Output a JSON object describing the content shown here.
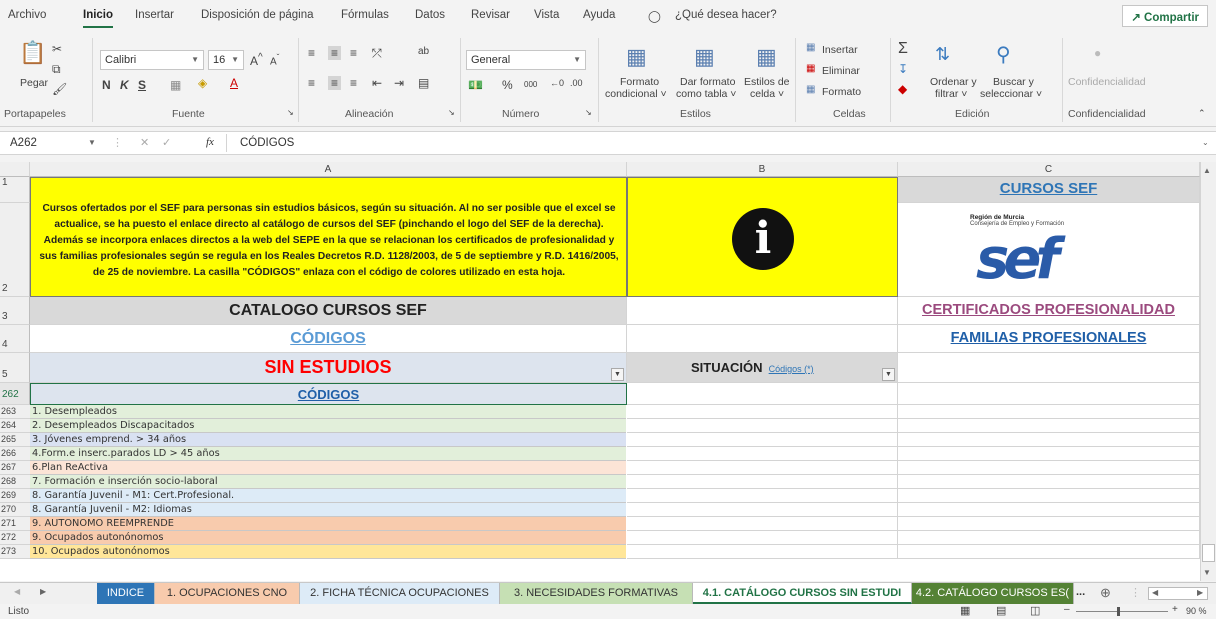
{
  "menu": {
    "items": [
      "Archivo",
      "Inicio",
      "Insertar",
      "Disposición de página",
      "Fórmulas",
      "Datos",
      "Revisar",
      "Vista",
      "Ayuda"
    ],
    "search_placeholder": "¿Qué desea hacer?",
    "share_label": "Compartir"
  },
  "ribbon": {
    "paste_label": "Pegar",
    "font_name": "Calibri",
    "font_size": "16",
    "bold": "N",
    "italic": "K",
    "underline": "S",
    "number_format": "General",
    "percent": "%",
    "thousands": "000",
    "cond_format_l1": "Formato",
    "cond_format_l2": "condicional ˅",
    "table_format_l1": "Dar formato",
    "table_format_l2": "como tabla ˅",
    "cell_styles_l1": "Estilos de",
    "cell_styles_l2": "celda ˅",
    "insert": "Insertar",
    "delete": "Eliminar",
    "format": "Formato",
    "sort_l1": "Ordenar y",
    "sort_l2": "filtrar ˅",
    "find_l1": "Buscar y",
    "find_l2": "seleccionar ˅",
    "confidential": "Confidencialidad",
    "groups": [
      "Portapapeles",
      "Fuente",
      "Alineación",
      "Número",
      "Estilos",
      "Celdas",
      "Edición",
      "Confidencialidad"
    ]
  },
  "formula_bar": {
    "name_box": "A262",
    "content": "CÓDIGOS"
  },
  "columns": [
    "A",
    "B",
    "C"
  ],
  "cells": {
    "a1_text": "Cursos ofertados por el SEF para personas sin estudios básicos, según su situación. Al no ser posible que el excel se actualice, se ha puesto el enlace directo al catálogo de cursos del SEF (pinchando el logo del SEF de la derecha). Además se incorpora enlaces directos a la web del SEPE en la que se relacionan los certificados de profesionalidad y sus familias profesionales según se regula en los Reales Decretos R.D. 1128/2003, de 5 de septiembre y R.D. 1416/2005, de 25 de noviembre. La casilla \"CÓDIGOS\" enlaza con el código de colores utilizado en esta hoja.",
    "info_symbol": "i",
    "c1": "CURSOS SEF",
    "logo_l1": "Región de Murcia",
    "logo_l2": "Consejería de Empleo y Formación",
    "logo_text": "sef",
    "a3": "CATALOGO CURSOS SEF",
    "c3": "CERTIFICADOS PROFESIONALIDAD",
    "a4": "CÓDIGOS",
    "c4": "FAMILIAS PROFESIONALES",
    "a5": "SIN ESTUDIOS",
    "b5": "SITUACIÓN",
    "b5_link": "Códigos (*)",
    "a262": "CÓDIGOS"
  },
  "row_labels": {
    "r1": "1",
    "r2": "2",
    "r3": "3",
    "r4": "4",
    "r5": "5",
    "r262": "262"
  },
  "code_rows": [
    {
      "row": "263",
      "text": "1. Desempleados",
      "color": "#e2efda"
    },
    {
      "row": "264",
      "text": "2. Desempleados Discapacitados",
      "color": "#e2efda"
    },
    {
      "row": "265",
      "text": "3. Jóvenes emprend. > 34 años",
      "color": "#d9e1f2"
    },
    {
      "row": "266",
      "text": "4.Form.e inserc.parados LD > 45 años",
      "color": "#e2efda"
    },
    {
      "row": "267",
      "text": "6.Plan ReActiva",
      "color": "#fce4d6"
    },
    {
      "row": "268",
      "text": "7. Formación e inserción socio-laboral",
      "color": "#e2efda"
    },
    {
      "row": "269",
      "text": "8. Garantía Juvenil - M1: Cert.Profesional.",
      "color": "#ddebf7"
    },
    {
      "row": "270",
      "text": "8. Garantía Juvenil - M2: Idiomas",
      "color": "#ddebf7"
    },
    {
      "row": "271",
      "text": "9. AUTONOMO REEMPRENDE",
      "color": "#f8cbad"
    },
    {
      "row": "272",
      "text": "9. Ocupados autonónomos",
      "color": "#f8cbad"
    },
    {
      "row": "273",
      "text": "10. Ocupados autonónomos",
      "color": "#ffe699"
    }
  ],
  "tabs": [
    {
      "label": "INDICE",
      "bg": "#2e75b6",
      "fg": "#ffffff"
    },
    {
      "label": "1. OCUPACIONES CNO",
      "bg": "#f8cbad",
      "fg": "#333333"
    },
    {
      "label": "2. FICHA TÉCNICA OCUPACIONES",
      "bg": "#ddebf7",
      "fg": "#333333"
    },
    {
      "label": "3. NECESIDADES FORMATIVAS",
      "bg": "#c6e0b4",
      "fg": "#333333"
    },
    {
      "label": "4.1. CATÁLOGO CURSOS SIN ESTUDI",
      "bg": "#ffffff",
      "fg": "#217346"
    },
    {
      "label": "4.2. CATÁLOGO CURSOS ES(",
      "bg": "#548235",
      "fg": "#ffffff"
    }
  ],
  "tabs_more": "...",
  "status": {
    "ready": "Listo",
    "zoom": "90 %"
  },
  "colors": {
    "yellow": "#ffff00",
    "header_gray": "#d9d9d9",
    "link_blue": "#2e75b6",
    "red": "#ff0000",
    "purple_link": "#7f3f6f",
    "excel_green": "#217346",
    "row_blue": "#dde4ee"
  }
}
